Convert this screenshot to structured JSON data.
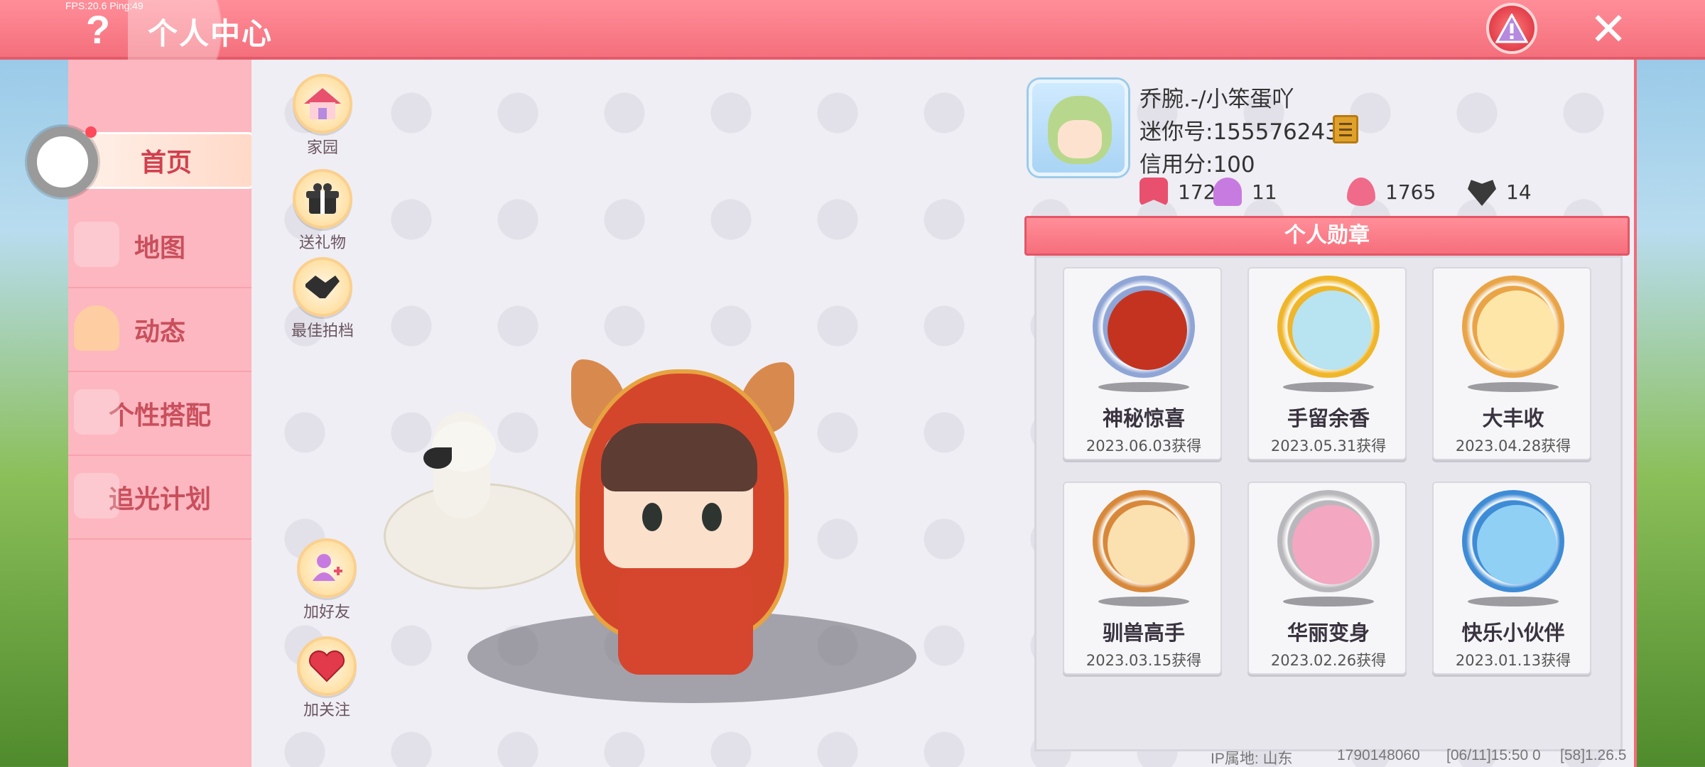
{
  "overlay": {
    "fps": "FPS:20.6  Ping:49"
  },
  "header": {
    "title": "个人中心"
  },
  "sidebar": {
    "items": [
      {
        "label": "首页",
        "active": true
      },
      {
        "label": "地图"
      },
      {
        "label": "动态"
      },
      {
        "label": "个性搭配"
      },
      {
        "label": "追光计划"
      }
    ]
  },
  "actions": {
    "home": "家园",
    "gift": "送礼物",
    "partner": "最佳拍档",
    "add_friend": "加好友",
    "follow": "加关注"
  },
  "profile": {
    "name": "乔腕.-/小笨蛋吖",
    "mini_id": "迷你号:1555762433",
    "credit": "信用分:100",
    "stats": [
      {
        "icon": "bookmark-icon",
        "value": "172",
        "color": "#e8506e"
      },
      {
        "icon": "trophy-person-icon",
        "value": "11",
        "color": "#c77be0"
      },
      {
        "icon": "flame-icon",
        "value": "1765",
        "color": "#f06a8a"
      },
      {
        "icon": "heart-icon",
        "value": "14",
        "color": "#3a3a3a"
      }
    ]
  },
  "badges": {
    "title": "个人勋章",
    "items": [
      {
        "name": "神秘惊喜",
        "date": "2023.06.03获得",
        "ring": "#8fa5d6",
        "core": "#c4331f"
      },
      {
        "name": "手留余香",
        "date": "2023.05.31获得",
        "ring": "#f0b62a",
        "core": "#b8e3f1"
      },
      {
        "name": "大丰收",
        "date": "2023.04.28获得",
        "ring": "#e9a447",
        "core": "#fde6a8"
      },
      {
        "name": "驯兽高手",
        "date": "2023.03.15获得",
        "ring": "#d8883a",
        "core": "#fbe0b0"
      },
      {
        "name": "华丽变身",
        "date": "2023.02.26获得",
        "ring": "#b8b8bc",
        "core": "#f3a7c0"
      },
      {
        "name": "快乐小伙伴",
        "date": "2023.01.13获得",
        "ring": "#3e8bd6",
        "core": "#8fd0f4"
      }
    ]
  },
  "footer": {
    "ip": "IP属地: 山东",
    "uid": "1790148060",
    "time": "[06/11]15:50 0",
    "version": "[58]1.26.5"
  },
  "colors": {
    "accent": "#f46f7c",
    "sidebar": "#fdb7c0",
    "panel": "#efeef4"
  }
}
